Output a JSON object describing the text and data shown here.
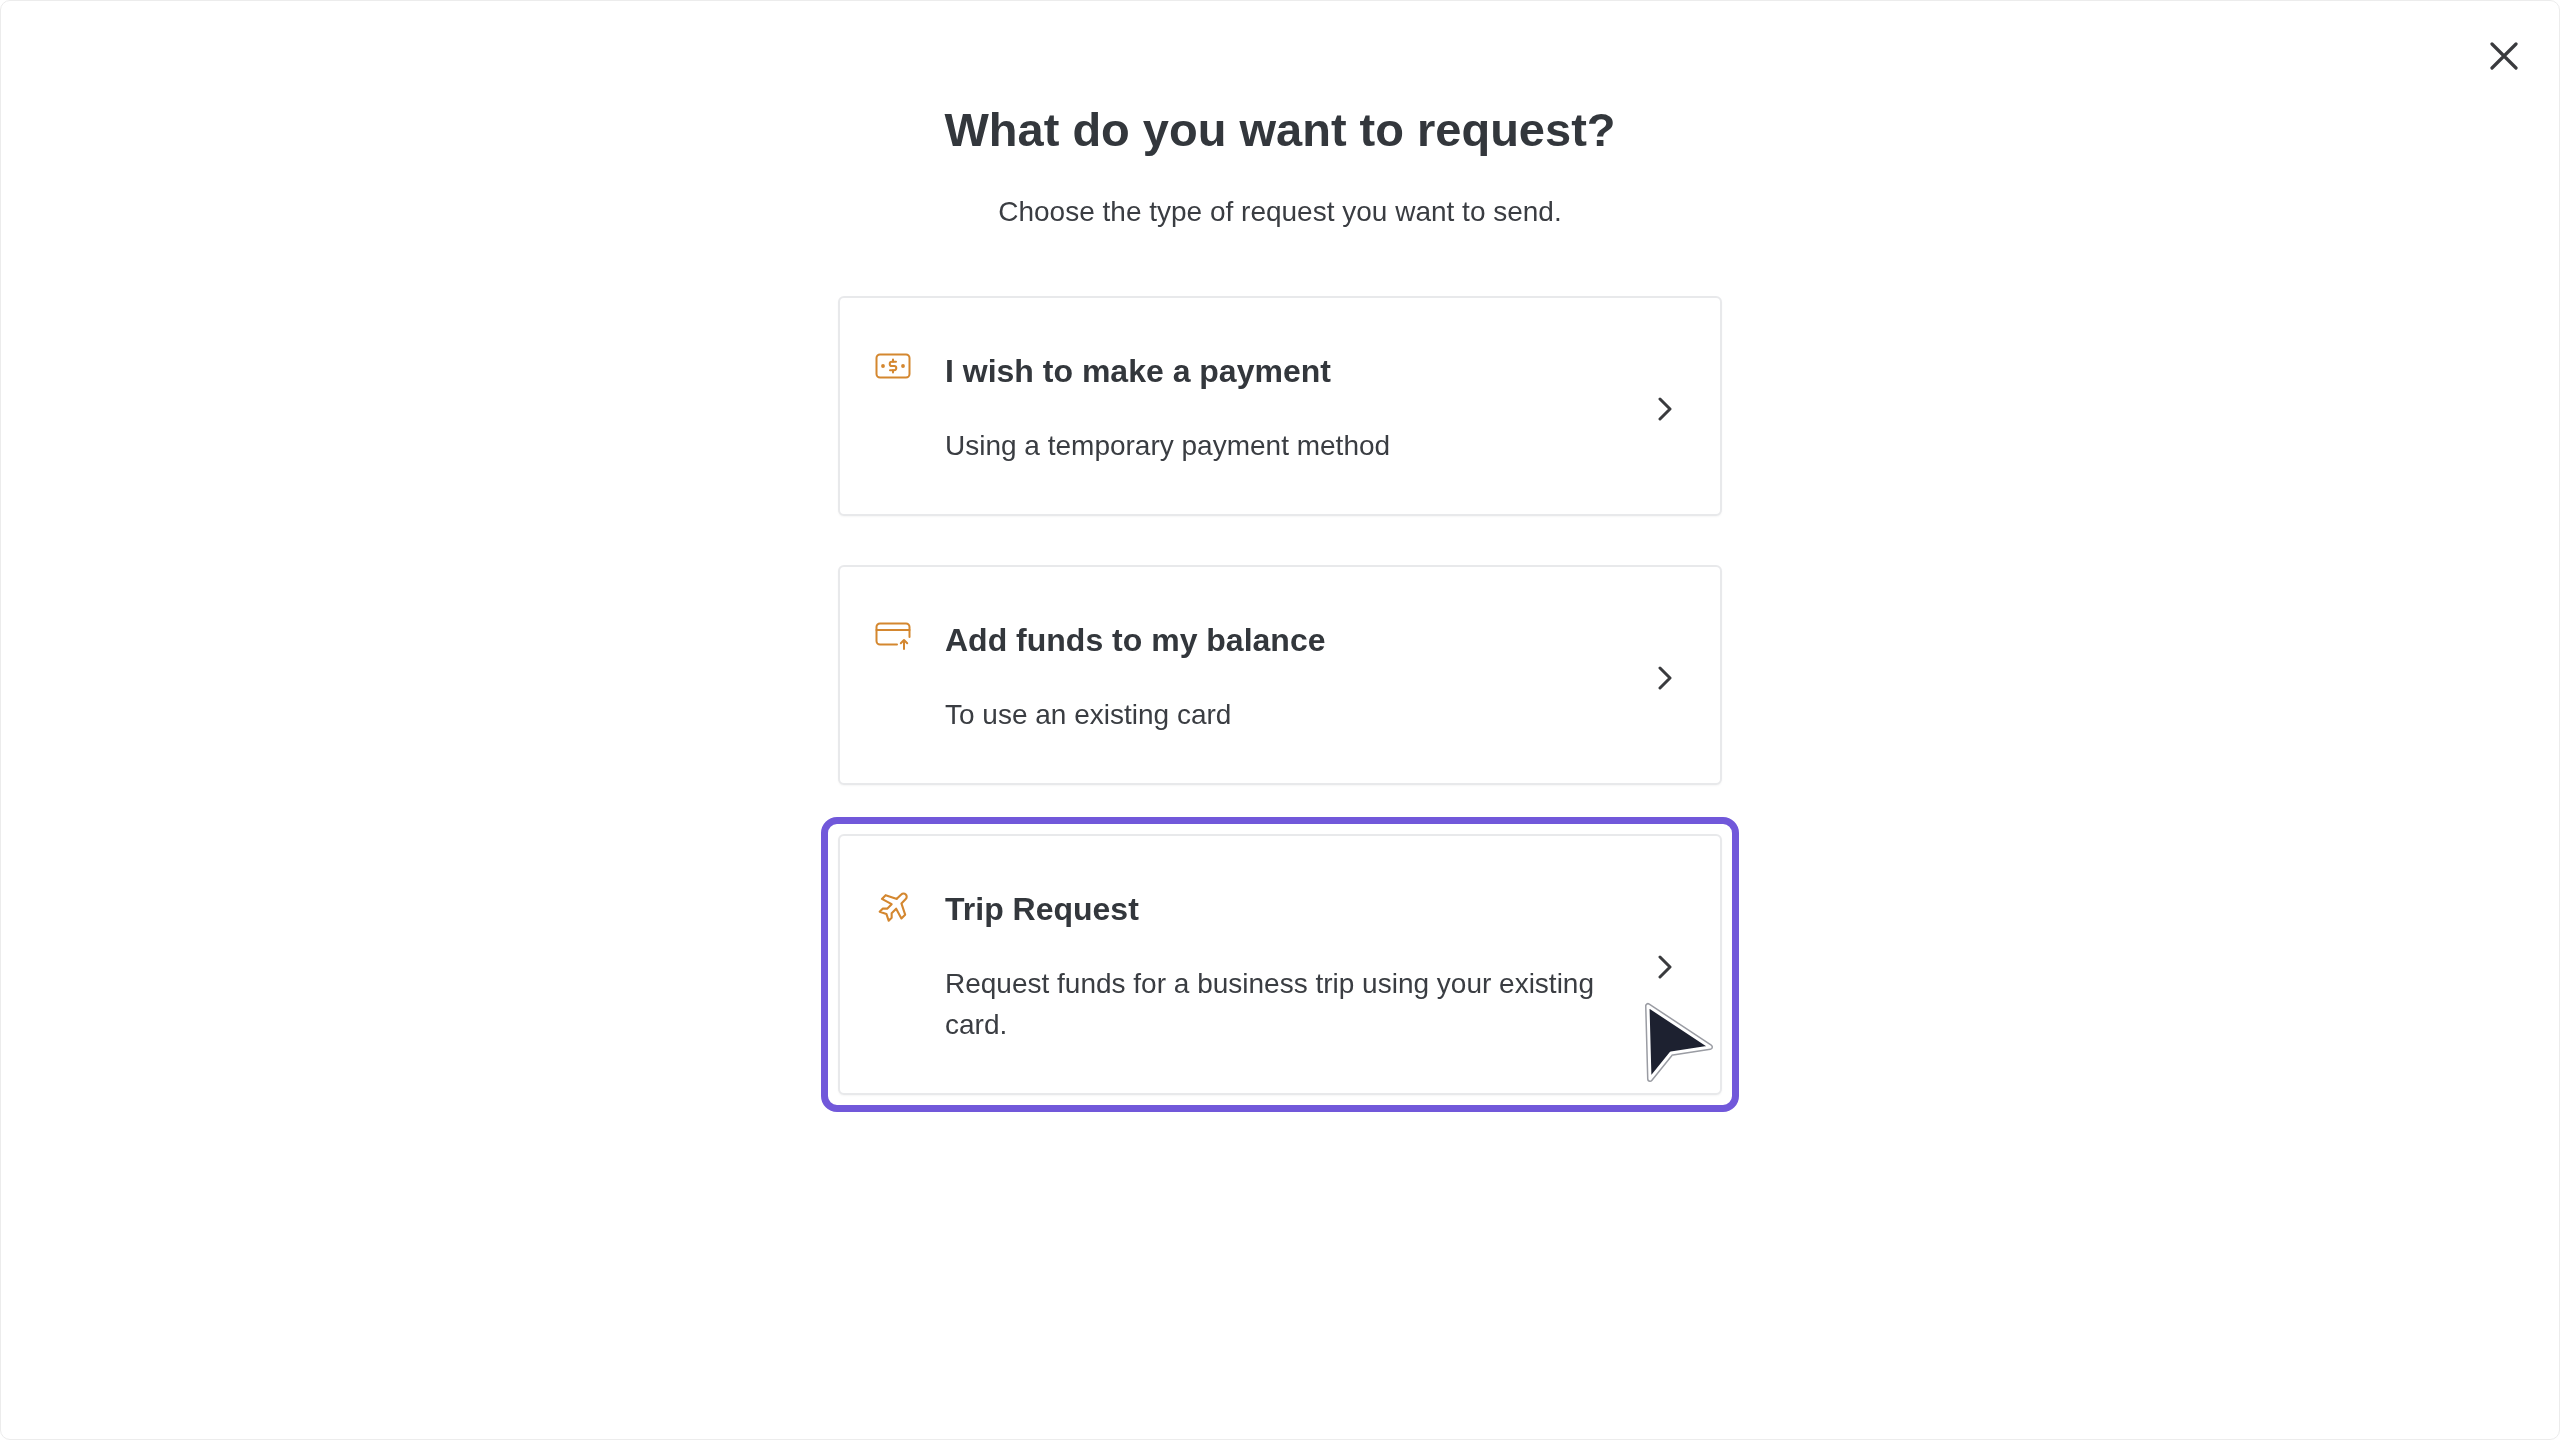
{
  "dialog": {
    "title": "What do you want to request?",
    "subtitle": "Choose the type of request you want to send."
  },
  "options": [
    {
      "kind": "payment",
      "title": "I wish to make a payment",
      "description": "Using a temporary payment method",
      "selected": false
    },
    {
      "kind": "add_funds",
      "title": "Add funds to my balance",
      "description": "To use an existing card",
      "selected": false
    },
    {
      "kind": "trip",
      "title": "Trip Request",
      "description": "Request funds for a business trip using your existing card.",
      "selected": true
    }
  ]
}
